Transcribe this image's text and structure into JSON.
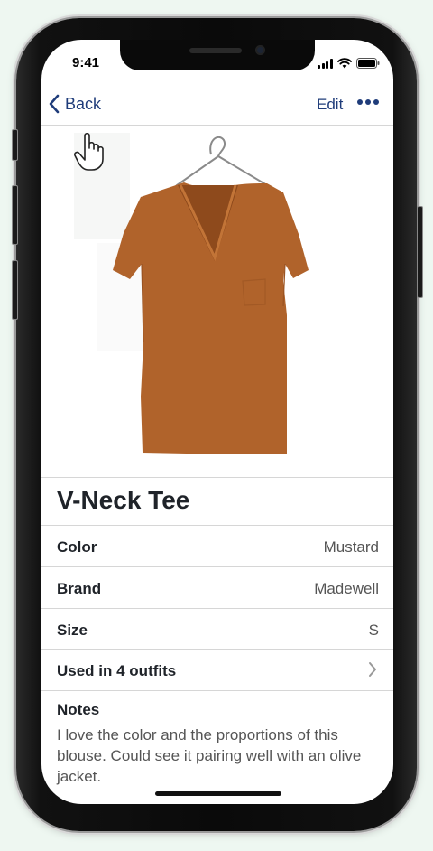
{
  "status_bar": {
    "time": "9:41",
    "icons": [
      "cellular-signal-icon",
      "wifi-icon",
      "battery-icon"
    ]
  },
  "nav": {
    "back_label": "Back",
    "edit_label": "Edit",
    "more_icon": "ellipsis-icon"
  },
  "item": {
    "title": "V-Neck Tee",
    "image": "mustard-v-neck-tee-on-hanger",
    "color_hex": "#b0632b",
    "details": [
      {
        "label": "Color",
        "value": "Mustard"
      },
      {
        "label": "Brand",
        "value": "Madewell"
      },
      {
        "label": "Size",
        "value": "S"
      }
    ],
    "outfits_label": "Used in 4 outfits",
    "notes_label": "Notes",
    "notes_text": "I love the color and the proportions of this blouse. Could see it pairing well with an olive jacket."
  },
  "colors": {
    "accent": "#1f3c7a",
    "background": "#eef7f1"
  }
}
